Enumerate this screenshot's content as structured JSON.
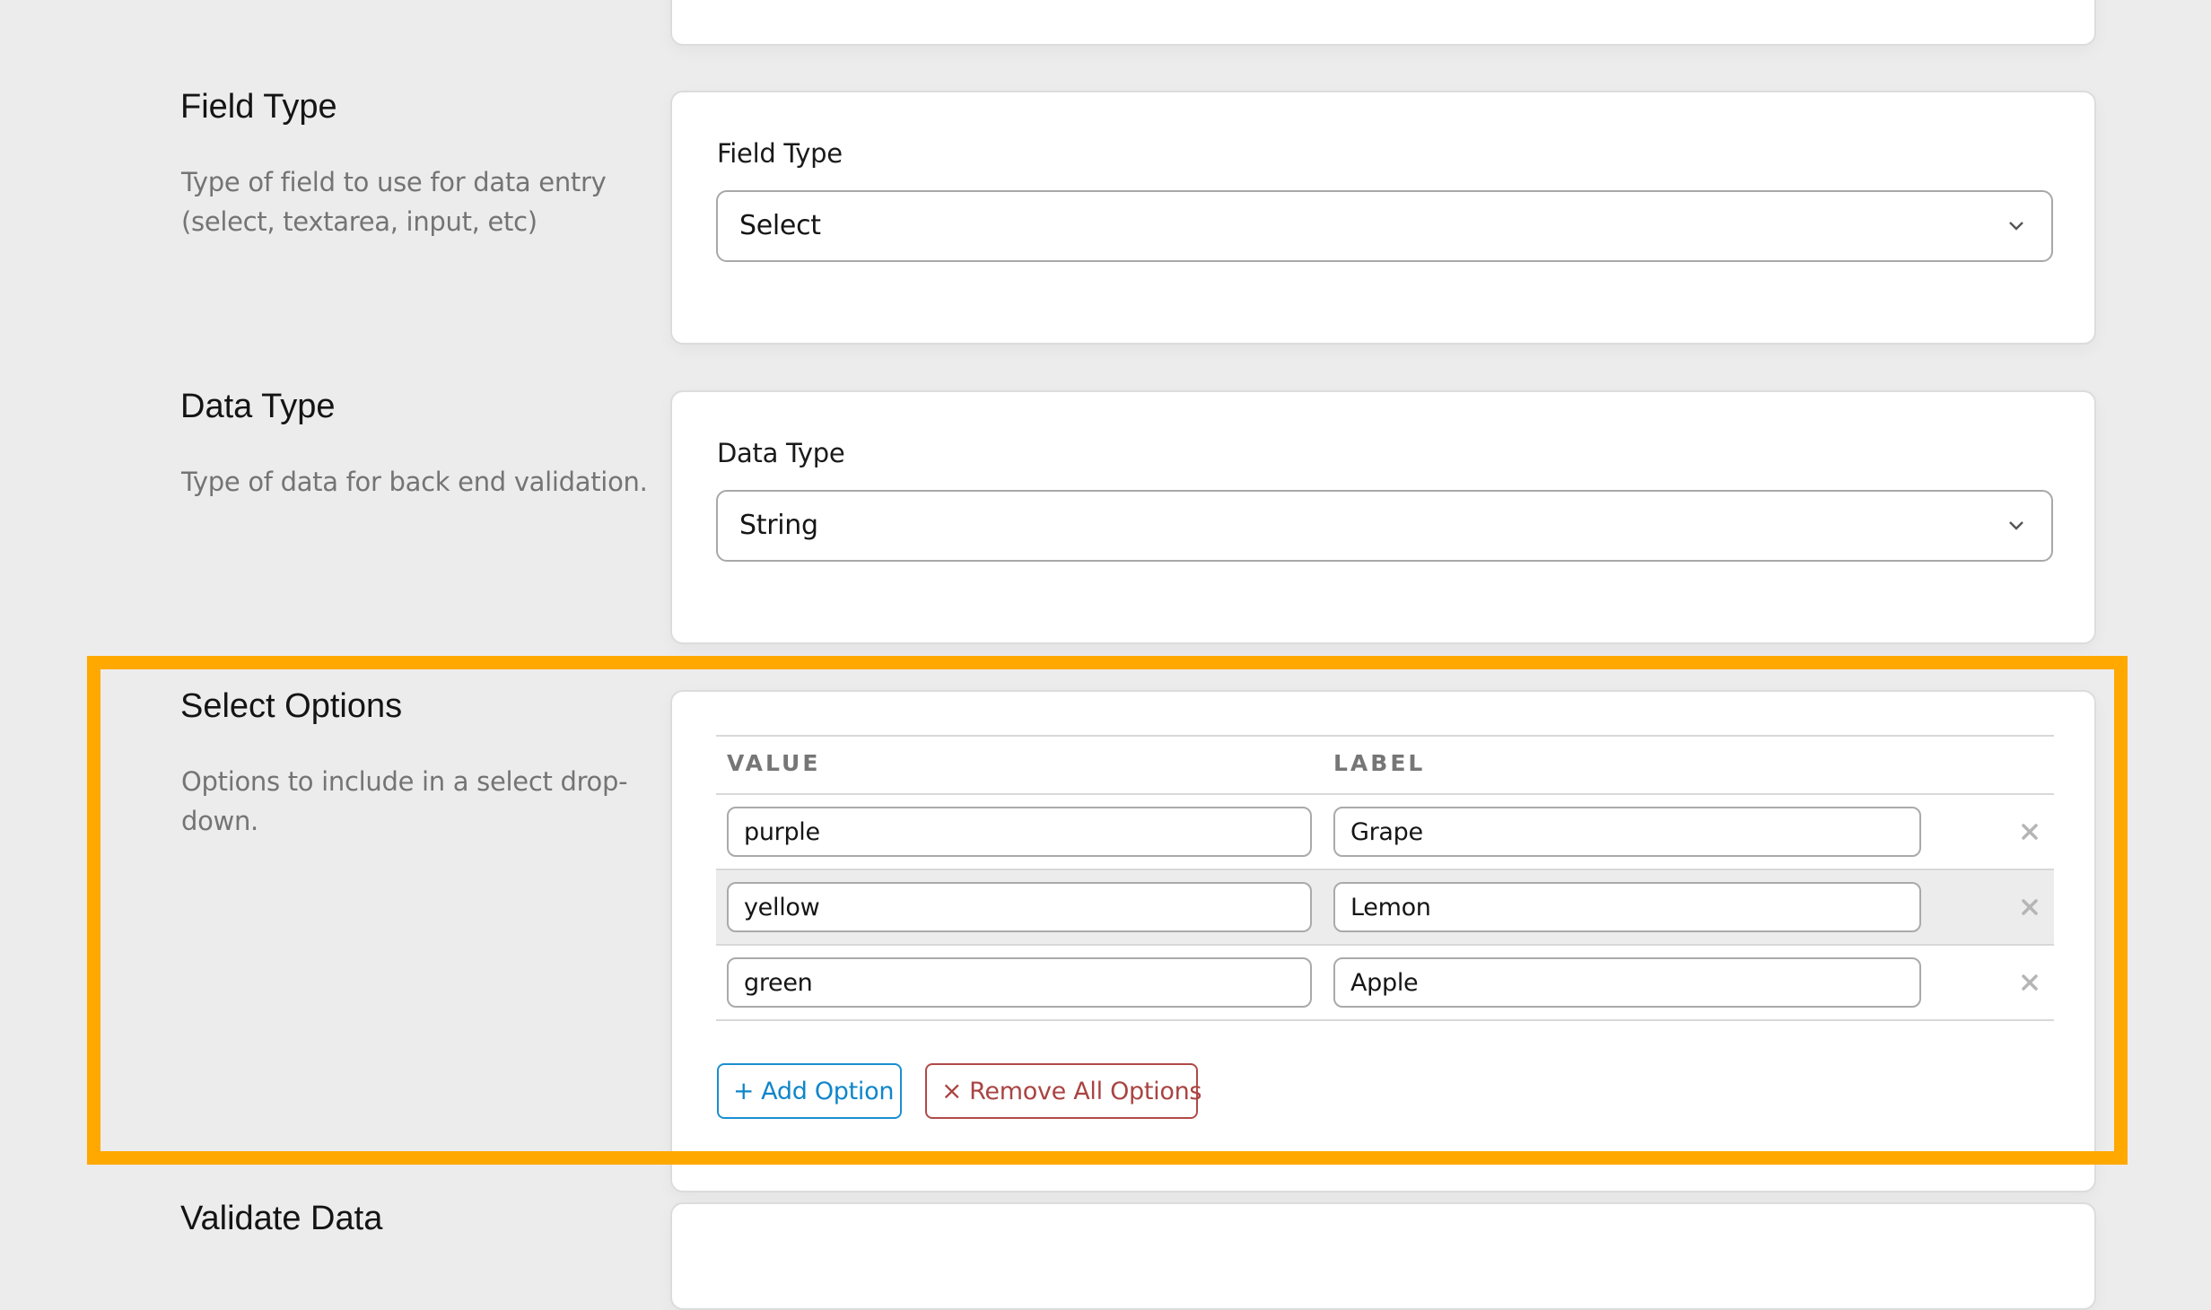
{
  "sections": {
    "field_type": {
      "title": "Field Type",
      "description": "Type of field to use for data entry (select, textarea, input, etc)",
      "field_label": "Field Type",
      "selected": "Select"
    },
    "data_type": {
      "title": "Data Type",
      "description": "Type of data for back end validation.",
      "field_label": "Data Type",
      "selected": "String"
    },
    "select_options": {
      "title": "Select Options",
      "description": "Options to include in a select drop-down.",
      "columns": {
        "value": "VALUE",
        "label": "LABEL"
      },
      "rows": [
        {
          "value": "purple",
          "label": "Grape"
        },
        {
          "value": "yellow",
          "label": "Lemon"
        },
        {
          "value": "green",
          "label": "Apple"
        }
      ],
      "add_button": {
        "icon": "plus-icon",
        "glyph": "+",
        "label": "Add Option"
      },
      "remove_all_button": {
        "icon": "close-icon",
        "glyph": "×",
        "label": "Remove All Options"
      },
      "row_remove_icon": "close-icon"
    },
    "validate_data": {
      "title": "Validate Data"
    }
  },
  "colors": {
    "highlight": "#ffa800",
    "add_button": "#0f86c9",
    "remove_button": "#a94442",
    "background": "#ececec"
  }
}
